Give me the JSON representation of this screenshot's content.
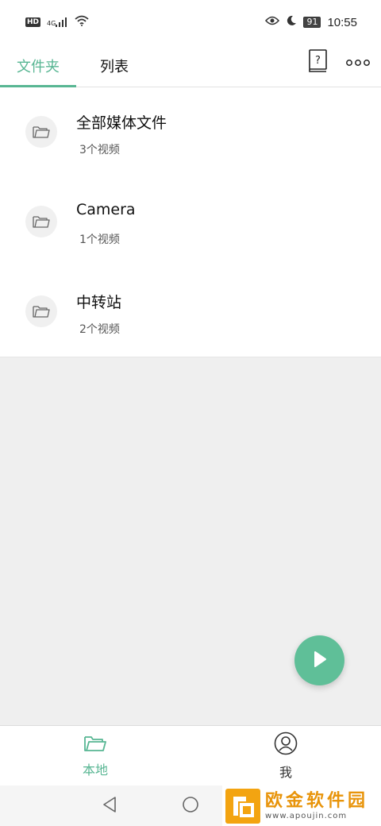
{
  "status_bar": {
    "network_badge": "HD",
    "network_type": "4G",
    "battery": "91",
    "time": "10:55",
    "icons": [
      "hd-badge",
      "signal-icon",
      "wifi-icon",
      "eye-icon",
      "moon-icon",
      "battery-icon"
    ]
  },
  "tabs": [
    {
      "label": "文件夹",
      "active": true
    },
    {
      "label": "列表",
      "active": false
    }
  ],
  "toolbar": {
    "help_icon": "help-book-icon",
    "more_icon": "more-dots-icon"
  },
  "folders": [
    {
      "name": "全部媒体文件",
      "count": "3个视频"
    },
    {
      "name": "Camera",
      "count": "1个视频"
    },
    {
      "name": "中转站",
      "count": "2个视频"
    }
  ],
  "fab": {
    "icon": "play-icon"
  },
  "bottom_nav": [
    {
      "label": "本地",
      "icon": "folder-icon",
      "active": true
    },
    {
      "label": "我",
      "icon": "user-icon",
      "active": false
    }
  ],
  "system_nav": {
    "icons": [
      "back-icon",
      "home-icon"
    ]
  },
  "watermark": {
    "title": "欧金软件园",
    "subtitle": "www.apoujin.com"
  },
  "colors": {
    "accent": "#58b693",
    "fab": "#5fbf98",
    "background_empty": "#efefef",
    "watermark": "#e8940a"
  }
}
